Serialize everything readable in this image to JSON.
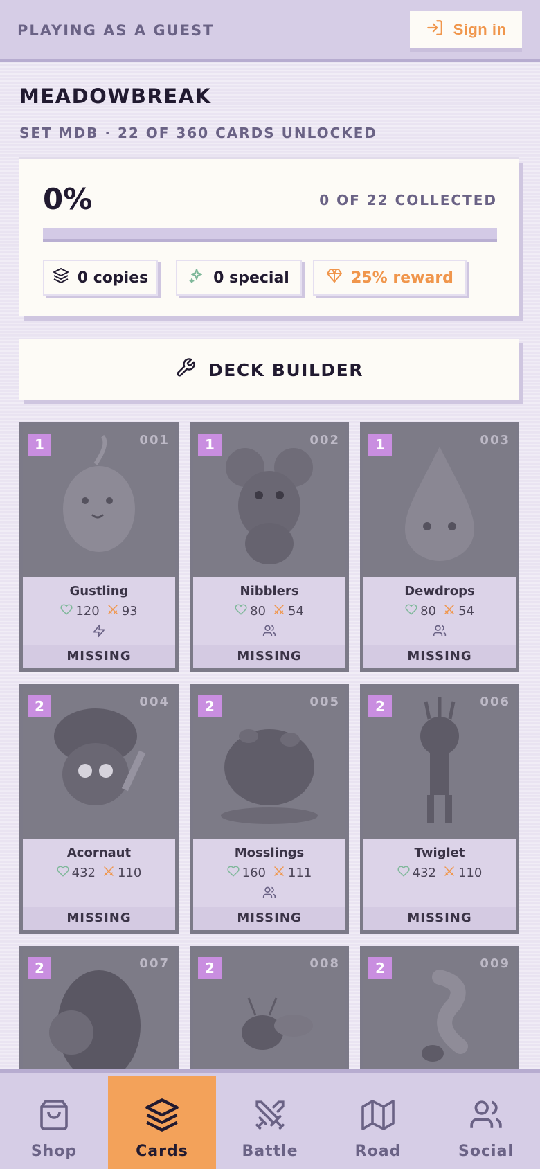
{
  "header": {
    "guest_label": "PLAYING AS A GUEST",
    "sign_in_label": "Sign in"
  },
  "set": {
    "title": "MEADOWBREAK",
    "subtitle": "SET MDB · 22 OF 360 CARDS UNLOCKED"
  },
  "progress": {
    "percent_label": "0%",
    "collected_label": "0 OF 22 COLLECTED",
    "fill_fraction": 0,
    "chips": {
      "copies": "0 copies",
      "special": "0 special",
      "reward": "25% reward"
    }
  },
  "deck_builder_label": "DECK BUILDER",
  "cards": [
    {
      "badge": "1",
      "number": "001",
      "name": "Gustling",
      "health": "120",
      "attack": "93",
      "trait_icon": "lightning-icon",
      "status": "MISSING"
    },
    {
      "badge": "1",
      "number": "002",
      "name": "Nibblers",
      "health": "80",
      "attack": "54",
      "trait_icon": "users-icon",
      "status": "MISSING"
    },
    {
      "badge": "1",
      "number": "003",
      "name": "Dewdrops",
      "health": "80",
      "attack": "54",
      "trait_icon": "users-icon",
      "status": "MISSING"
    },
    {
      "badge": "2",
      "number": "004",
      "name": "Acornaut",
      "health": "432",
      "attack": "110",
      "trait_icon": "",
      "status": "MISSING"
    },
    {
      "badge": "2",
      "number": "005",
      "name": "Mosslings",
      "health": "160",
      "attack": "111",
      "trait_icon": "users-icon",
      "status": "MISSING"
    },
    {
      "badge": "2",
      "number": "006",
      "name": "Twiglet",
      "health": "432",
      "attack": "110",
      "trait_icon": "",
      "status": "MISSING"
    },
    {
      "badge": "2",
      "number": "007"
    },
    {
      "badge": "2",
      "number": "008"
    },
    {
      "badge": "2",
      "number": "009"
    }
  ],
  "nav": {
    "shop": "Shop",
    "cards": "Cards",
    "battle": "Battle",
    "road": "Road",
    "social": "Social",
    "active": "cards"
  },
  "colors": {
    "accent": "#f0964c",
    "badge": "#c98ee0",
    "background": "#e9e3f1"
  }
}
